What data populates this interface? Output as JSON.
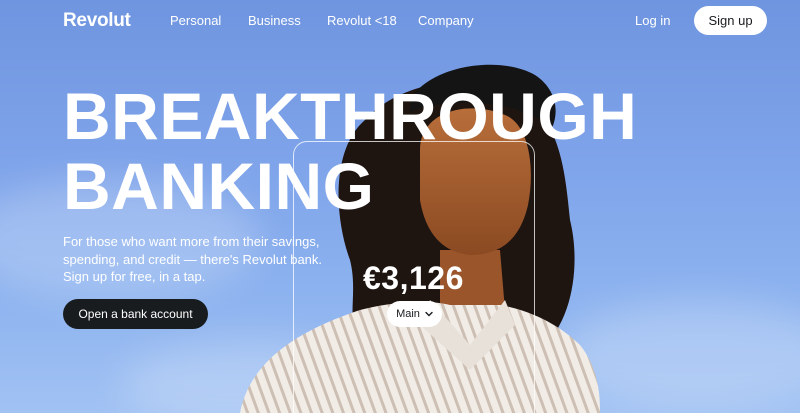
{
  "nav": {
    "logo": "Revolut",
    "links": [
      "Personal",
      "Business",
      "Revolut <18",
      "Company"
    ],
    "login": "Log in",
    "signup": "Sign up"
  },
  "hero": {
    "headline_line1": "BREAKTHROUGH",
    "headline_line2": "BANKING",
    "subtext": "For those who want more from their savings, spending, and credit — there's Revolut bank. Sign up for free, in a tap.",
    "cta": "Open a bank account"
  },
  "card": {
    "balance": "€3,126",
    "account": "Main",
    "chevron_icon": "chevron-down-icon"
  },
  "colors": {
    "sky": "#7fa4ea",
    "button_dark": "#191c1f",
    "button_light": "#ffffff"
  }
}
